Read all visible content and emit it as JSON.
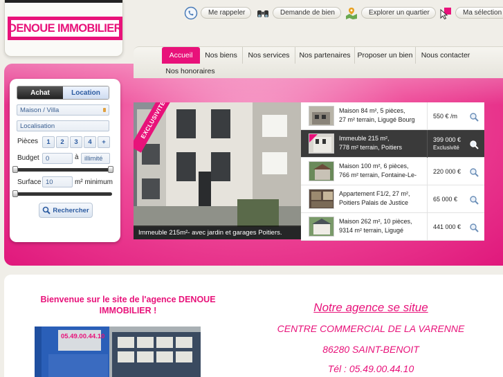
{
  "logo": {
    "text": "DENOUE IMMOBILIER"
  },
  "top_links": [
    {
      "icon": "phone-icon",
      "label": "Me rappeler"
    },
    {
      "icon": "binoculars-icon",
      "label": "Demande de bien"
    },
    {
      "icon": "map-pin-icon",
      "label": "Explorer un quartier"
    },
    {
      "icon": "cursor-icon",
      "label": "Ma sélection"
    }
  ],
  "nav": [
    {
      "label": "Accueil",
      "active": true
    },
    {
      "label": "Nos biens"
    },
    {
      "label": "Nos services"
    },
    {
      "label": "Nos partenaires"
    },
    {
      "label": "Proposer un bien"
    },
    {
      "label": "Nous contacter"
    },
    {
      "label": "Nos honoraires"
    }
  ],
  "search": {
    "tab_buy": "Achat",
    "tab_rent": "Location",
    "type_value": "Maison / Villa",
    "location_placeholder": "Localisation",
    "rooms_label": "Pièces",
    "rooms_options": [
      "1",
      "2",
      "3",
      "4",
      "+"
    ],
    "budget_label": "Budget",
    "budget_min": "0",
    "budget_to": "à",
    "budget_max": "illimité",
    "surface_label": "Surface",
    "surface_value": "10",
    "surface_unit": "m² minimum",
    "search_button": "Rechercher"
  },
  "featured": {
    "badge": "EXCLUSIVITE",
    "caption": "Immeuble 215m²- avec jardin et garages Poitiers."
  },
  "listings": [
    {
      "line1": "Maison 84 m², 5 pièces,",
      "line2": "27 m² terrain, Ligugé Bourg",
      "price": "550 € /m",
      "sub": ""
    },
    {
      "line1": "Immeuble 215 m²,",
      "line2": "778 m² terrain, Poitiers",
      "price": "399 000 €",
      "sub": "Exclusivité",
      "highlight": true
    },
    {
      "line1": "Maison 100 m², 6 pièces,",
      "line2": "766 m² terrain, Fontaine-Le-",
      "price": "220 000 €",
      "sub": ""
    },
    {
      "line1": "Appartement F1/2, 27 m²,",
      "line2": "Poitiers Palais de Justice",
      "price": "65 000 €",
      "sub": ""
    },
    {
      "line1": "Maison 262 m², 10 pièces,",
      "line2": "9314 m² terrain, Ligugé",
      "price": "441 000 €",
      "sub": ""
    }
  ],
  "content": {
    "welcome": "Bienvenue sur le site de l'agence DENOUE IMMOBILIER !",
    "agency_title": "Notre agence se situe",
    "agency_line1": "CENTRE COMMERCIAL DE LA VARENNE",
    "agency_line2": "86280 SAINT-BENOIT",
    "agency_phone": "Tél : 05.49.00.44.10",
    "photo_sign": "05.49.00.44.10"
  },
  "colors": {
    "brand_pink": "#e8127a",
    "link_blue": "#2a5aa0"
  }
}
